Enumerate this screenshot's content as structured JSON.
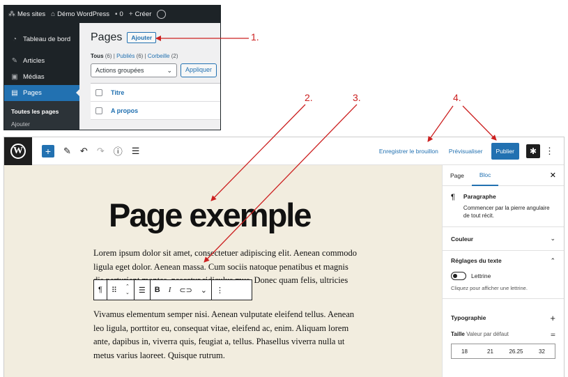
{
  "admin": {
    "bar": {
      "sites": "Mes sites",
      "site_name": "Démo WordPress",
      "comments": "0",
      "create": "Créer"
    },
    "menu": {
      "dashboard": "Tableau de bord",
      "articles": "Articles",
      "media": "Médias",
      "pages": "Pages",
      "all_pages": "Toutes les pages",
      "add": "Ajouter"
    },
    "main": {
      "title": "Pages",
      "add_button": "Ajouter",
      "filter_all": "Tous",
      "filter_all_count": "(6)",
      "filter_published": "Publiés",
      "filter_published_count": "(6)",
      "filter_trash": "Corbeille",
      "filter_trash_count": "(2)",
      "bulk_actions": "Actions groupées",
      "apply": "Appliquer",
      "col_title": "Titre",
      "row1": "A propos"
    }
  },
  "editor": {
    "toolbar": {
      "save_draft": "Enregistrer le brouillon",
      "preview": "Prévisualiser",
      "publish": "Publier"
    },
    "page_title": "Page exemple",
    "paragraph1": "Lorem ipsum dolor sit amet, consectetuer adipiscing elit. Aenean commodo ligula eget dolor. Aenean massa. Cum sociis natoque penatibus et magnis dis parturient montes, nascetur ridiculus mus. Donec quam felis, ultricies nec, pellentesque eu, pretium quis, sem.",
    "paragraph2": "Vivamus elementum semper nisi. Aenean vulputate eleifend tellus. Aenean leo ligula, porttitor eu, consequat vitae, eleifend ac, enim. Aliquam lorem ante, dapibus in, viverra quis, feugiat a, tellus. Phasellus viverra nulla ut metus varius laoreet. Quisque rutrum.",
    "block_toolbar": {
      "bold": "B",
      "italic": "I"
    },
    "sidebar": {
      "tab_page": "Page",
      "tab_block": "Bloc",
      "block_name": "Paragraphe",
      "block_desc": "Commencer par la pierre angulaire de tout récit.",
      "color_panel": "Couleur",
      "text_settings": "Réglages du texte",
      "drop_cap": "Lettrine",
      "drop_cap_hint": "Cliquez pour afficher une lettrine.",
      "typography": "Typographie",
      "size_label": "Taille",
      "size_value": "Valeur par défaut",
      "sizes": [
        "18",
        "21",
        "26.25",
        "32"
      ]
    }
  },
  "annotations": [
    "1.",
    "2.",
    "3.",
    "4."
  ],
  "colors": {
    "accent": "#2271b1",
    "admin_dark": "#1d2327",
    "canvas_bg": "#f2eddf",
    "annotation": "#cc2020"
  }
}
